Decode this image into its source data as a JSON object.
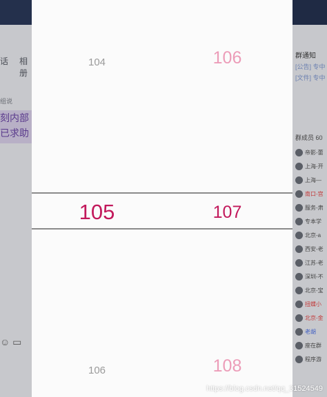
{
  "background": {
    "tabs": [
      "话",
      "相册"
    ],
    "sub_label": "组说",
    "highlight_lines": [
      "刻内部",
      "已求助"
    ],
    "right_panel": {
      "title": "群通知",
      "announcements": [
        "[公告] 专中",
        "[文件] 专中"
      ],
      "members_header": "群成员 60",
      "members": [
        {
          "name": "帝影-蕾",
          "style": "normal"
        },
        {
          "name": "上海-开",
          "style": "normal"
        },
        {
          "name": "上海—",
          "style": "normal"
        },
        {
          "name": "南口-宫",
          "style": "red"
        },
        {
          "name": "服务-肃",
          "style": "normal"
        },
        {
          "name": "专本学",
          "style": "normal"
        },
        {
          "name": "北京-a",
          "style": "normal"
        },
        {
          "name": "西安-老",
          "style": "normal"
        },
        {
          "name": "江苏-老",
          "style": "normal"
        },
        {
          "name": "深圳-不",
          "style": "normal"
        },
        {
          "name": "北京-宝",
          "style": "normal"
        },
        {
          "name": "扭蝶小",
          "style": "red"
        },
        {
          "name": "北京-金",
          "style": "red"
        },
        {
          "name": "老胡",
          "style": "blue"
        },
        {
          "name": "座在群",
          "style": "normal"
        },
        {
          "name": "程序游",
          "style": "normal"
        }
      ]
    }
  },
  "picker": {
    "left_column": {
      "above": "104",
      "selected": "105",
      "below": "106"
    },
    "right_column": {
      "above": "106",
      "selected": "107",
      "below": "108"
    },
    "colors": {
      "selected": "#c2185b",
      "faint_pink": "#ec9cb8",
      "faint_gray": "#9a9a9a",
      "divider": "#8a8a8a"
    }
  },
  "watermark": "https://blog.csdn.net/qq_31524549"
}
